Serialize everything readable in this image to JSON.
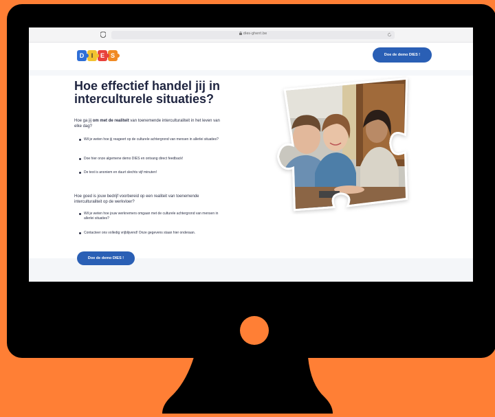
{
  "browser": {
    "url": "dies-ghent.be"
  },
  "header": {
    "logo_letters": [
      "D",
      "I",
      "E",
      "S"
    ],
    "cta_label": "Doe de demo DIES !"
  },
  "hero": {
    "title": "Hoe effectief handel jij in interculturele situaties?",
    "section1": {
      "intro_prefix": "Hoe ga jij ",
      "intro_bold": "om met de realiteit",
      "intro_suffix": " van toenemende interculturaliteit in het leven van elke dag?",
      "bullets": [
        "Wil je weten hoe jij reageert op de culturele achtergrond van mensen in allerlei situaties?",
        "Doe hier onze algemene demo DIES en ontvang direct feedback!",
        "De test is anoniem en duurt slechts vijf minuten!"
      ]
    },
    "section2": {
      "intro": "Hoe goed is jouw bedrijf voorbereid op een realiteit van toenemende interculturaliteit op de werkvloer?",
      "bullets": [
        "Wil je weten hoe jouw werknemers omgaan met de culturele achtergrond van mensen in allerlei situaties?",
        "Contacteer ons volledig vrijblijvend! Onze gegevens staan hier onderaan."
      ]
    },
    "cta_label": "Doe de demo DIES !"
  },
  "colors": {
    "background": "#ff7f35",
    "monitor": "#000000",
    "button": "#2a5fb5",
    "title": "#1f2540"
  },
  "icons": [
    "shield-icon",
    "lock-icon",
    "reload-icon",
    "power-dot"
  ]
}
